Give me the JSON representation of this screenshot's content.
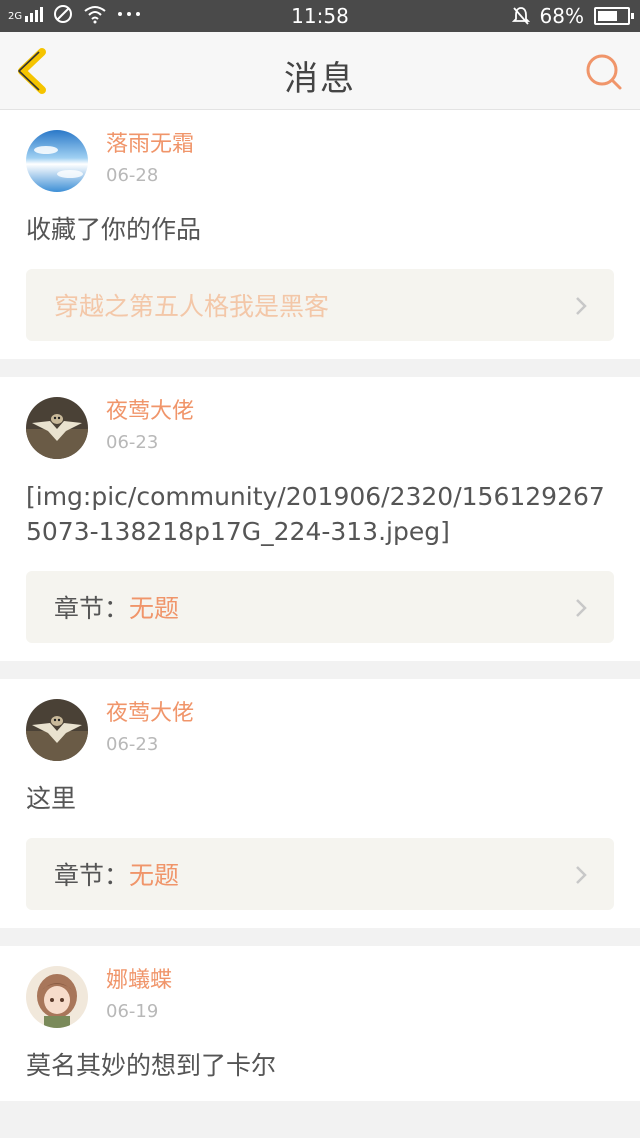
{
  "status_bar": {
    "network": "2G",
    "time": "11:58",
    "battery": "68%",
    "battery_level": 0.68,
    "icons": [
      "signal-icon",
      "no-sim-icon",
      "wifi-icon",
      "more-icon",
      "mute-icon",
      "battery-icon"
    ]
  },
  "nav": {
    "title": "消息",
    "back_icon": "back-chevron-icon",
    "search_icon": "search-icon",
    "accent": "#f5c400",
    "search_color": "#f0956a"
  },
  "messages": [
    {
      "user": "落雨无霜",
      "date": "06-28",
      "text": "收藏了你的作品",
      "link": {
        "title": "穿越之第五人格我是黑客"
      },
      "avatar": "sky-avatar"
    },
    {
      "user": "夜莺大佬",
      "date": "06-23",
      "text": "[img:pic/community/201906/2320/1561292675073-138218p17G_224-313.jpeg]",
      "link": {
        "label": "章节：",
        "value": "无题"
      },
      "avatar": "owl-avatar"
    },
    {
      "user": "夜莺大佬",
      "date": "06-23",
      "text": "这里",
      "link": {
        "label": "章节：",
        "value": "无题"
      },
      "avatar": "owl-avatar"
    },
    {
      "user": "娜蟻蝶",
      "date": "06-19",
      "text": "莫名其妙的想到了卡尔",
      "avatar": "anime-girl-avatar"
    }
  ],
  "colors": {
    "username": "#f0956a",
    "date": "#b8b8b8",
    "text": "#555555",
    "link_bg": "#f5f4ef",
    "muted_link_title": "#f3c7a8"
  }
}
